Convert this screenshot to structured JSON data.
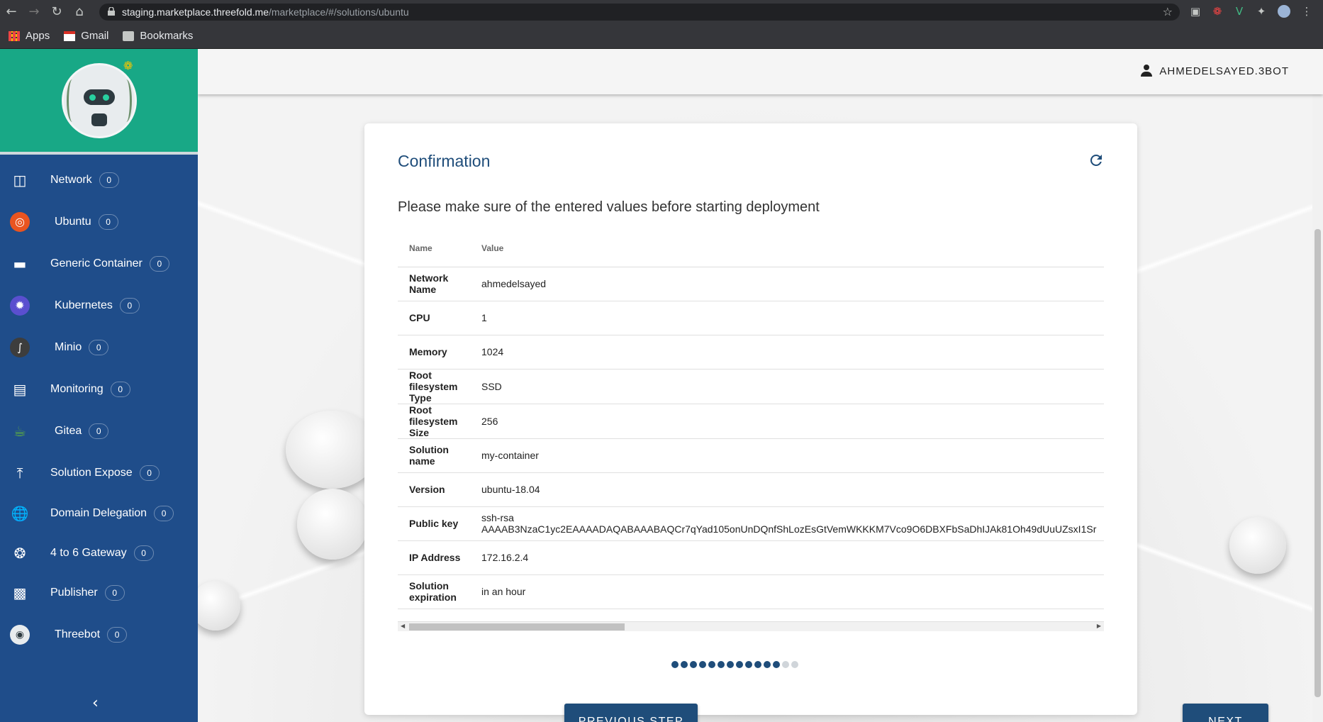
{
  "browser": {
    "url_host": "staging.marketplace.threefold.me",
    "url_path": "/marketplace/#/solutions/ubuntu",
    "bookmarks": [
      {
        "label": "Apps"
      },
      {
        "label": "Gmail"
      },
      {
        "label": "Bookmarks"
      }
    ]
  },
  "user": {
    "name": "AHMEDELSAYED.3BOT"
  },
  "sidebar": {
    "items": [
      {
        "label": "Network",
        "count": "0"
      },
      {
        "label": "Ubuntu",
        "count": "0"
      },
      {
        "label": "Generic Container",
        "count": "0"
      },
      {
        "label": "Kubernetes",
        "count": "0"
      },
      {
        "label": "Minio",
        "count": "0"
      },
      {
        "label": "Monitoring",
        "count": "0"
      },
      {
        "label": "Gitea",
        "count": "0"
      },
      {
        "label": "Solution Expose",
        "count": "0"
      },
      {
        "label": "Domain Delegation",
        "count": "0"
      },
      {
        "label": "4 to 6 Gateway",
        "count": "0"
      },
      {
        "label": "Publisher",
        "count": "0"
      },
      {
        "label": "Threebot",
        "count": "0"
      }
    ]
  },
  "card": {
    "title": "Confirmation",
    "subtitle": "Please make sure of the entered values before starting deployment",
    "headers": {
      "name": "Name",
      "value": "Value"
    },
    "rows": [
      {
        "name": "Network Name",
        "value": "ahmedelsayed"
      },
      {
        "name": "CPU",
        "value": "1"
      },
      {
        "name": "Memory",
        "value": "1024"
      },
      {
        "name": "Root filesystem Type",
        "value": "SSD"
      },
      {
        "name": "Root filesystem Size",
        "value": "256"
      },
      {
        "name": "Solution name",
        "value": "my-container"
      },
      {
        "name": "Version",
        "value": "ubuntu-18.04"
      },
      {
        "name": "Public key",
        "value": "ssh-rsa",
        "value2": "AAAAB3NzaC1yc2EAAAADAQABAAABAQCr7qYad105onUnDQnfShLozEsGtVemWKKKM7Vco9O6DBXFbSaDhIJAk81Oh49dUuUZsxI1Sr"
      },
      {
        "name": "IP Address",
        "value": "172.16.2.4"
      },
      {
        "name": "Solution expiration",
        "value": "in an hour"
      }
    ],
    "steps_completed": 12,
    "steps_total": 14,
    "prev_label": "PREVIOUS STEP",
    "next_label": "NEXT"
  },
  "colors": {
    "accent": "#1f4d7a",
    "sidebar": "#1f4d8a",
    "sidebar_head": "#18a886"
  }
}
